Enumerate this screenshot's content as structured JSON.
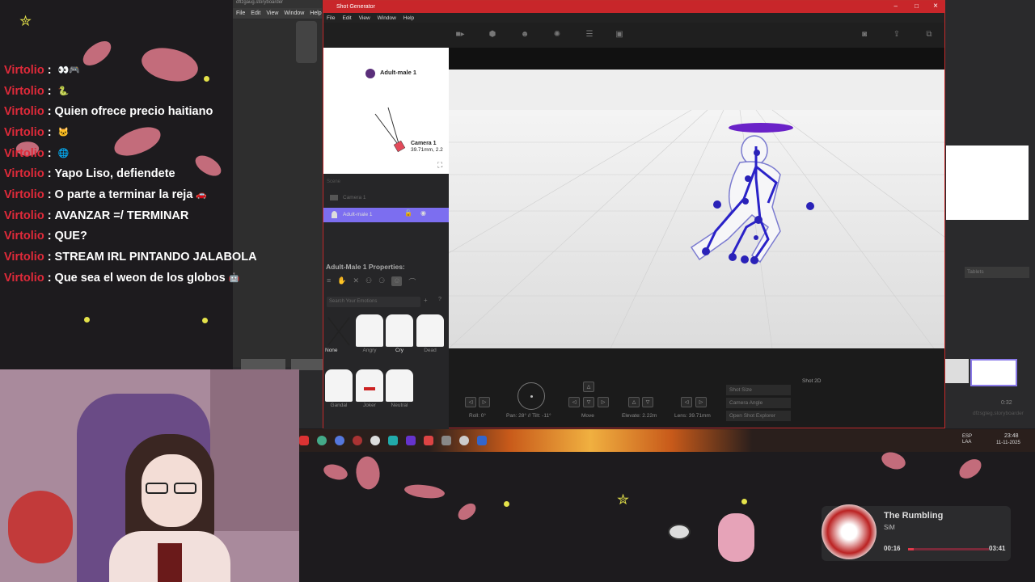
{
  "chat": {
    "messages": [
      {
        "user": "Virtolio",
        "text": "",
        "emote": "👀🎮"
      },
      {
        "user": "Virtolio",
        "text": "",
        "emote": "🐍"
      },
      {
        "user": "Virtolio",
        "text": "Quien ofrece precio haitiano",
        "emote": ""
      },
      {
        "user": "Virtolio",
        "text": "",
        "emote": "🐱"
      },
      {
        "user": "Virtolio",
        "text": "",
        "emote": "🌐"
      },
      {
        "user": "Virtolio",
        "text": "Yapo Liso, defiendete",
        "emote": ""
      },
      {
        "user": "Virtolio",
        "text": "O parte a terminar la reja",
        "emote": "🚗"
      },
      {
        "user": "Virtolio",
        "text": "AVANZAR =/ TERMINAR",
        "emote": ""
      },
      {
        "user": "Virtolio",
        "text": "QUE?",
        "emote": ""
      },
      {
        "user": "Virtolio",
        "text": "STREAM IRL PINTANDO JALABOLA",
        "emote": ""
      },
      {
        "user": "Virtolio",
        "text": "Que sea el weon de los globos",
        "emote": "🤖"
      }
    ]
  },
  "bg_app": {
    "title": "dflzgaug.storyboarder",
    "menu": [
      "File",
      "Edit",
      "View",
      "Window",
      "Help"
    ],
    "right_label": "dfzsgteg.storyboarder",
    "time_label": "0:32",
    "field_label": "Tablets"
  },
  "shot_generator": {
    "title": "Shot Generator",
    "menu": [
      "File",
      "Edit",
      "View",
      "Window",
      "Help"
    ],
    "window_controls": [
      "–",
      "□",
      "×"
    ],
    "topview": {
      "character": "Adult-male 1",
      "camera": "Camera 1",
      "camera_info": "39.71mm, 2.2"
    },
    "scene_label": "Scene",
    "scene_items": [
      "Camera 1",
      "Adult-male 1"
    ],
    "properties_title": "Adult-Male 1 Properties:",
    "search_placeholder": "Search Your Emotions",
    "emotions": [
      "None",
      "Angry",
      "Cry",
      "Dead",
      "Gandal",
      "Joker",
      "Neutral"
    ],
    "controls": {
      "roll": "Roll: 0°",
      "pan_tilt": "Pan: 28° // Tilt: -11°",
      "move": "Move",
      "elevate": "Elevate: 2.22m",
      "lens": "Lens: 39.71mm"
    },
    "side_buttons": [
      "Shot Size",
      "Camera Angle",
      "Open Shot Explorer"
    ],
    "shot_label": "Shot 2D"
  },
  "taskbar": {
    "lang": "ESP\nLAA",
    "time": "23:48",
    "date": "11-11-2025"
  },
  "music": {
    "title": "The Rumbling",
    "artist": "SiM",
    "elapsed": "00:16",
    "total": "03:41",
    "progress": 0.07
  }
}
